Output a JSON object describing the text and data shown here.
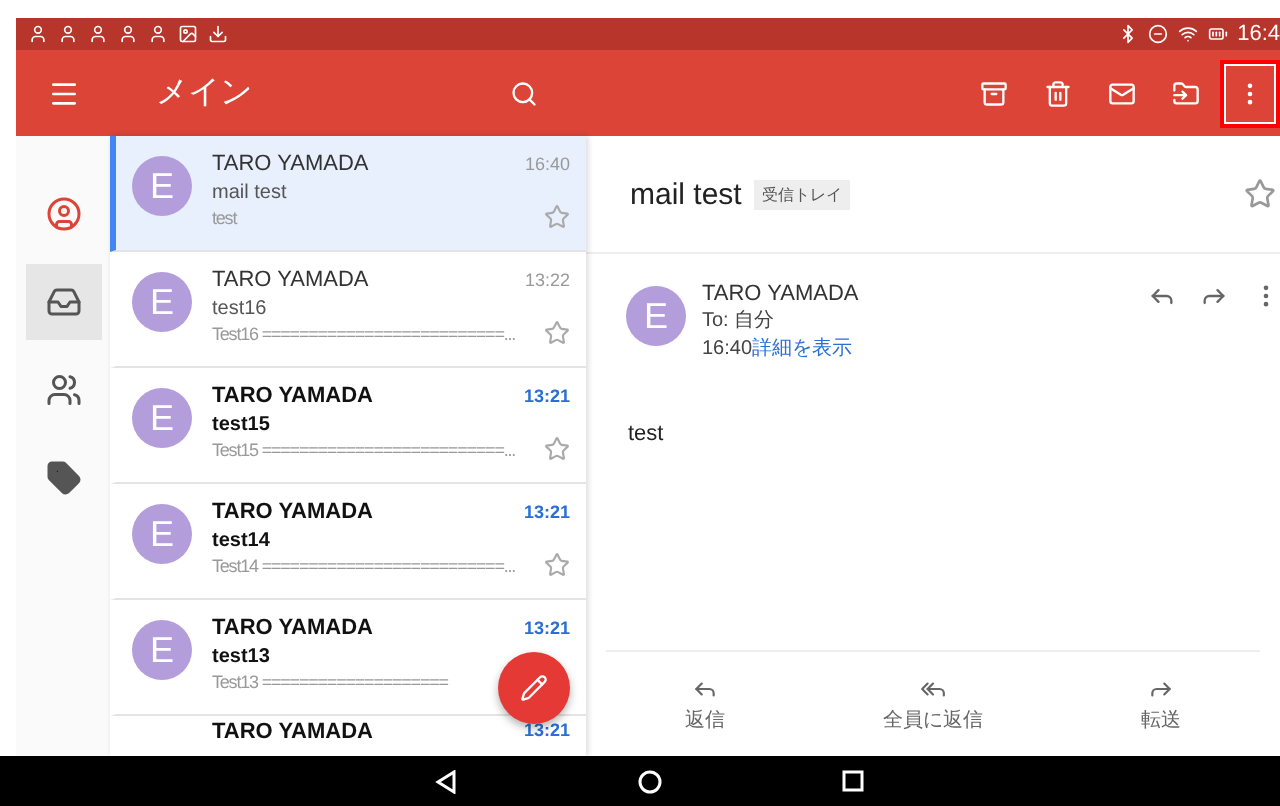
{
  "status_bar": {
    "time": "16:4"
  },
  "toolbar": {
    "title": "メイン",
    "actions": [
      {
        "kind": "archive",
        "outlined": false
      },
      {
        "kind": "delete",
        "outlined": false
      },
      {
        "kind": "mail",
        "outlined": false
      },
      {
        "kind": "move",
        "outlined": false
      },
      {
        "kind": "more",
        "outlined": true
      }
    ]
  },
  "rail": [
    {
      "kind": "account",
      "selected": false
    },
    {
      "kind": "inbox",
      "selected": true
    },
    {
      "kind": "contacts",
      "selected": false
    },
    {
      "kind": "labels",
      "selected": false
    }
  ],
  "emails": [
    {
      "avatar": "E",
      "sender": "TARO YAMADA",
      "time": "16:40",
      "subject": "mail test",
      "preview": "test",
      "unread": false,
      "selected": true,
      "star_shown": true
    },
    {
      "avatar": "E",
      "sender": "TARO YAMADA",
      "time": "13:22",
      "subject": "test16",
      "preview": "Test16 ==========================...",
      "unread": false,
      "selected": false,
      "star_shown": true
    },
    {
      "avatar": "E",
      "sender": "TARO YAMADA",
      "time": "13:21",
      "subject": "test15",
      "preview": "Test15 ==========================...",
      "unread": true,
      "selected": false,
      "star_shown": true
    },
    {
      "avatar": "E",
      "sender": "TARO YAMADA",
      "time": "13:21",
      "subject": "test14",
      "preview": "Test14 ==========================...",
      "unread": true,
      "selected": false,
      "star_shown": true
    },
    {
      "avatar": "E",
      "sender": "TARO YAMADA",
      "time": "13:21",
      "subject": "test13",
      "preview": "Test13 ====================",
      "unread": true,
      "selected": false,
      "star_shown": false
    },
    {
      "sender": "TARO YAMADA",
      "time": "13:21",
      "unread": true,
      "selected": false
    }
  ],
  "detail": {
    "subject": "mail test",
    "label": "受信トレイ",
    "avatar": "E",
    "sender": "TARO YAMADA",
    "to": "To: 自分",
    "time": "16:40",
    "details_link": "詳細を表示",
    "body": "test",
    "actions": [
      {
        "kind": "reply",
        "label": "返信"
      },
      {
        "kind": "reply_all",
        "label": "全員に返信"
      },
      {
        "kind": "forward",
        "label": "転送"
      }
    ]
  }
}
